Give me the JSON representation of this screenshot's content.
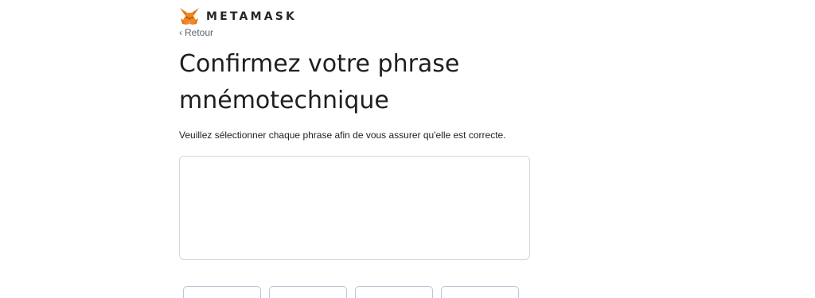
{
  "header": {
    "brand_name": "METAMASK",
    "logo_icon": "metamask-fox-icon",
    "back_icon": "chevron-left-icon",
    "back_label": "Retour"
  },
  "main": {
    "title": "Confirmez votre phrase mnémotechnique",
    "subtitle": "Veuillez sélectionner chaque phrase afin de vous assurer qu'elle est correcte."
  },
  "word_buttons": [
    {
      "label": ""
    },
    {
      "label": ""
    },
    {
      "label": ""
    },
    {
      "label": ""
    }
  ],
  "colors": {
    "fox_orange": "#e2761b",
    "text": "#24272a",
    "border": "#d6d9dc"
  }
}
